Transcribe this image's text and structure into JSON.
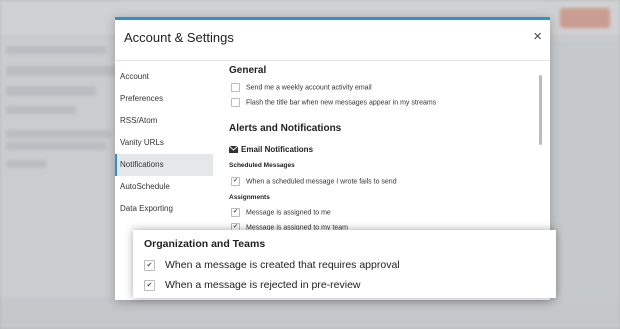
{
  "dialog": {
    "title": "Account & Settings",
    "close_glyph": "×"
  },
  "nav": {
    "items": [
      {
        "label": "Account"
      },
      {
        "label": "Preferences"
      },
      {
        "label": "RSS/Atom"
      },
      {
        "label": "Vanity URLs"
      },
      {
        "label": "Notifications"
      },
      {
        "label": "AutoSchedule"
      },
      {
        "label": "Data Exporting"
      }
    ],
    "active": "Notifications"
  },
  "general": {
    "heading": "General",
    "options": [
      {
        "label": "Send me a weekly account activity email",
        "checked": false
      },
      {
        "label": "Flash the title bar when new messages appear in my streams",
        "checked": false
      }
    ]
  },
  "alerts": {
    "heading": "Alerts and Notifications",
    "email_heading": "Email Notifications",
    "email_icon": "envelope-icon",
    "scheduled_heading": "Scheduled Messages",
    "scheduled_options": [
      {
        "label": "When a scheduled message I wrote fails to send",
        "checked": true
      }
    ],
    "assignments_heading": "Assignments",
    "assignment_options": [
      {
        "label": "Message is assigned to me",
        "checked": true
      },
      {
        "label": "Message is assigned to my team",
        "checked": true
      }
    ]
  },
  "zoom": {
    "heading": "Organization and Teams",
    "options": [
      {
        "label": "When a message is created that requires approval",
        "checked": true
      },
      {
        "label": "When a message is rejected in pre-review",
        "checked": true
      }
    ]
  },
  "check_glyph": "✔",
  "colors": {
    "accent": "#2d8fd6"
  }
}
